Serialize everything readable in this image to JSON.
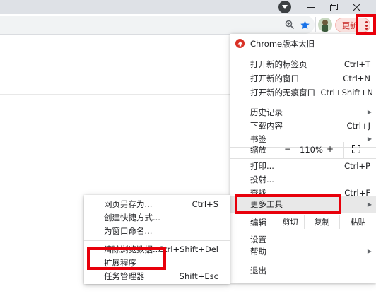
{
  "window": {
    "buttons": [
      {
        "name": "minimize-button",
        "glyph": "–"
      },
      {
        "name": "restore-button",
        "glyph": "❐"
      },
      {
        "name": "close-button",
        "glyph": "✕"
      }
    ]
  },
  "toolbar": {
    "update_label": "更新",
    "colors": {
      "update_bg": "#fbe3e0",
      "update_text": "#c5221f",
      "star": "#1a73e8"
    }
  },
  "main_menu": {
    "update_notice": "Chrome版本太旧",
    "new_tab": {
      "label": "打开新的标签页",
      "shortcut": "Ctrl+T"
    },
    "new_window": {
      "label": "打开新的窗口",
      "shortcut": "Ctrl+N"
    },
    "new_incognito": {
      "label": "打开新的无痕窗口",
      "shortcut": "Ctrl+Shift+N"
    },
    "history": {
      "label": "历史记录"
    },
    "downloads": {
      "label": "下载内容",
      "shortcut": "Ctrl+J"
    },
    "bookmarks": {
      "label": "书签"
    },
    "zoom": {
      "label": "缩放",
      "minus": "−",
      "value": "110%",
      "plus": "+"
    },
    "print": {
      "label": "打印...",
      "shortcut": "Ctrl+P"
    },
    "cast": {
      "label": "投射..."
    },
    "find": {
      "label": "查找...",
      "shortcut": "Ctrl+F"
    },
    "more_tools": {
      "label": "更多工具"
    },
    "edit": {
      "label": "编辑",
      "cut": "剪切",
      "copy": "复制",
      "paste": "粘贴"
    },
    "settings": {
      "label": "设置"
    },
    "help": {
      "label": "帮助"
    },
    "exit": {
      "label": "退出"
    }
  },
  "submenu": {
    "save_page": {
      "label": "网页另存为...",
      "shortcut": "Ctrl+S"
    },
    "create_shortcut": {
      "label": "创建快捷方式..."
    },
    "name_window": {
      "label": "为窗口命名..."
    },
    "clear_data": {
      "label": "清除浏览数据...",
      "shortcut": "Ctrl+Shift+Del"
    },
    "extensions": {
      "label": "扩展程序"
    },
    "task_manager": {
      "label": "任务管理器",
      "shortcut": "Shift+Esc"
    }
  },
  "highlight_color": "#e8000b"
}
